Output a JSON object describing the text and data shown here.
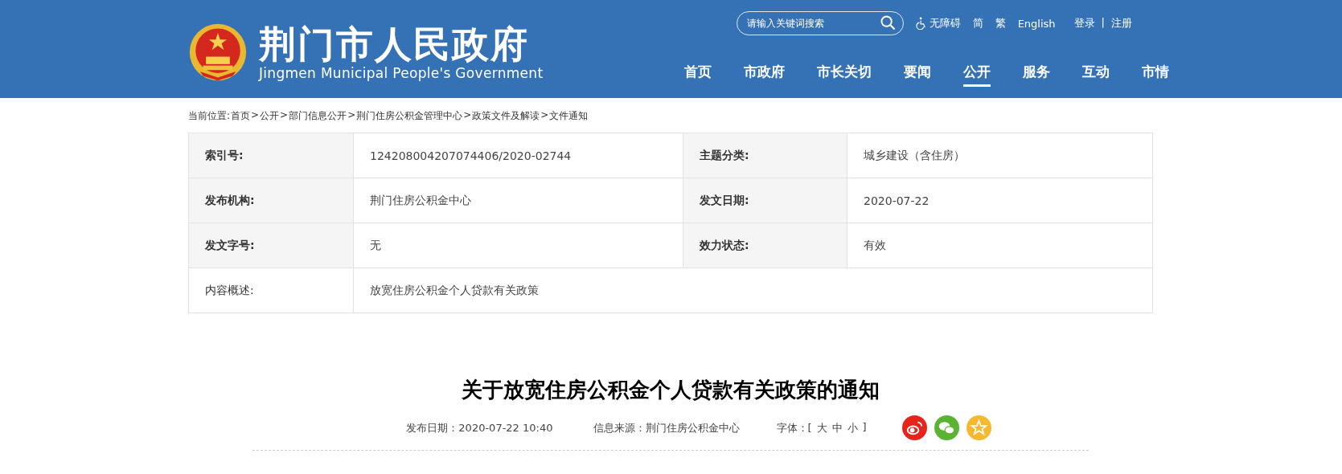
{
  "header": {
    "title": "荆门市人民政府",
    "subtitle": "Jingmen Municipal People's Government",
    "search": {
      "placeholder": "请输入关键词搜索"
    },
    "tools": [
      {
        "kind": "accessibility",
        "label": "无障碍"
      },
      {
        "kind": "link",
        "label": "简"
      },
      {
        "kind": "link",
        "label": "繁"
      },
      {
        "kind": "link",
        "label": "English"
      }
    ],
    "account": {
      "login": "登录",
      "separator": "|",
      "register": "注册"
    }
  },
  "nav": [
    {
      "label": "首页",
      "selected": false
    },
    {
      "label": "市政府",
      "selected": false
    },
    {
      "label": "市长关切",
      "selected": false
    },
    {
      "label": "要闻",
      "selected": false
    },
    {
      "label": "公开",
      "selected": true
    },
    {
      "label": "服务",
      "selected": false
    },
    {
      "label": "互动",
      "selected": false
    },
    {
      "label": "市情",
      "selected": false
    }
  ],
  "breadcrumb": {
    "label": "当前位置:",
    "separator": ">",
    "items": [
      "首页",
      "公开",
      "部门信息公开",
      "荆门住房公积金管理中心",
      "政策文件及解读",
      "文件通知"
    ]
  },
  "info_table": [
    {
      "kind": "pair",
      "cells": [
        {
          "label": "索引号:",
          "value": "124208004207074406/2020-02744"
        },
        {
          "label": "主题分类:",
          "value": "城乡建设（含住房）"
        }
      ]
    },
    {
      "kind": "pair",
      "cells": [
        {
          "label": "发布机构:",
          "value": "荆门住房公积金中心"
        },
        {
          "label": "发文日期:",
          "value": "2020-07-22"
        }
      ]
    },
    {
      "kind": "pair",
      "cells": [
        {
          "label": "发文字号:",
          "value": "无"
        },
        {
          "label": "效力状态:",
          "value": "有效"
        }
      ]
    },
    {
      "kind": "wide",
      "cells": [
        {
          "label": "内容概述:",
          "value": "放宽住房公积金个人贷款有关政策"
        }
      ]
    }
  ],
  "article": {
    "title": "关于放宽住房公积金个人贷款有关政策的通知",
    "publish_date": "发布日期：2020-07-22 10:40",
    "source": "信息来源：荆门住房公积金中心",
    "font_size": {
      "label": "字体：[",
      "options": [
        "大",
        "中",
        "小"
      ],
      "close": "]"
    },
    "share": [
      {
        "kind": "weibo",
        "color": "#e6241c"
      },
      {
        "kind": "wechat",
        "color": "#5bb431"
      },
      {
        "kind": "favorite",
        "color": "#f5b82e"
      }
    ]
  }
}
